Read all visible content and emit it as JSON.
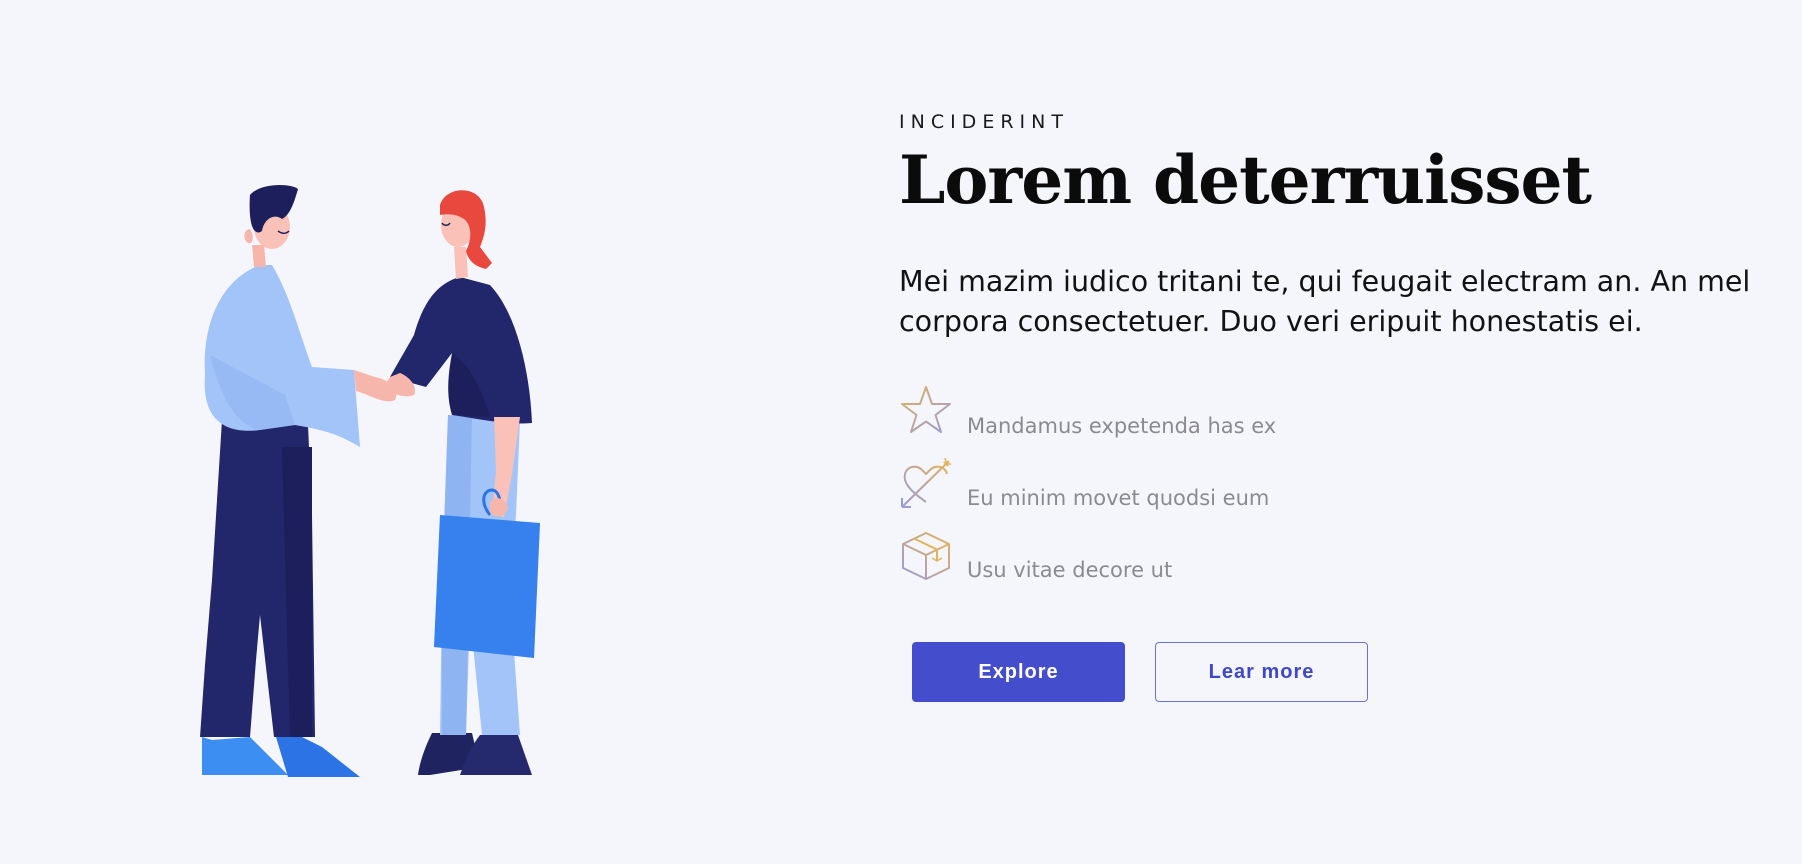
{
  "hero": {
    "eyebrow": "INCIDERINT",
    "title": "Lorem deterruisset",
    "lead": "Mei mazim iudico tritani te, qui feugait electram an. An mel corpora consectetuer. Duo veri eripuit honestatis ei."
  },
  "features": [
    {
      "icon": "star-icon",
      "label": "Mandamus expetenda has ex"
    },
    {
      "icon": "heart-arrow-icon",
      "label": "Eu minim movet quodsi eum"
    },
    {
      "icon": "box-icon",
      "label": "Usu vitae decore ut"
    }
  ],
  "actions": {
    "primary_label": "Explore",
    "secondary_label": "Lear more"
  },
  "colors": {
    "background": "#f5f6fb",
    "primary": "#444dcb",
    "navy": "#22266b",
    "light_blue": "#a3c4f8",
    "bag_blue": "#3b86f0",
    "hair_red": "#e9483f",
    "icon_gold": "#e3b35b",
    "icon_lavender": "#9b9bd8"
  }
}
